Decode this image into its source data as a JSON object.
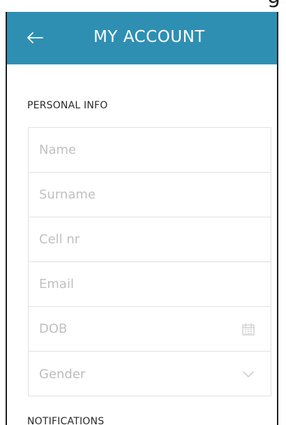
{
  "header": {
    "title": "MY ACCOUNT",
    "back_icon": "arrow-left-icon",
    "background_color": "#2e8fb3",
    "text_color": "#ffffff"
  },
  "partial_top_text": "g",
  "personal_info": {
    "title": "PERSONAL INFO",
    "fields": [
      {
        "placeholder": "Name"
      },
      {
        "placeholder": "Surname"
      },
      {
        "placeholder": "Cell nr"
      },
      {
        "placeholder": "Email"
      },
      {
        "placeholder": "DOB",
        "icon": "calendar-icon"
      },
      {
        "placeholder": "Gender",
        "icon": "chevron-down-icon"
      }
    ]
  },
  "notifications": {
    "title": "NOTIFICATIONS"
  }
}
